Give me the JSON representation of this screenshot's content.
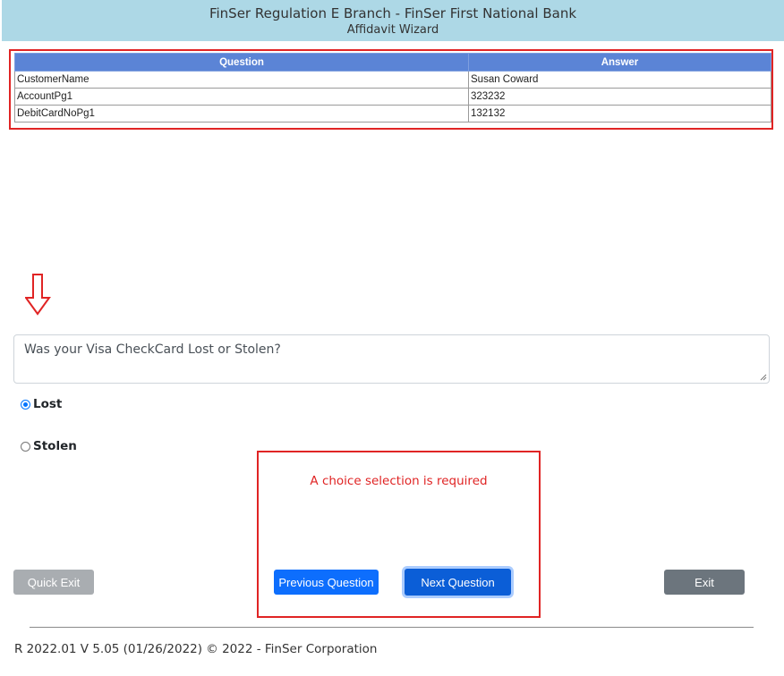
{
  "header": {
    "title": "FinSer Regulation E Branch - FinSer First National Bank",
    "subtitle": "Affidavit Wizard"
  },
  "answers_table": {
    "columns": [
      "Question",
      "Answer"
    ],
    "rows": [
      [
        "CustomerName",
        "Susan Coward"
      ],
      [
        "AccountPg1",
        "323232"
      ],
      [
        "DebitCardNoPg1",
        "132132"
      ]
    ]
  },
  "arrow_icon": "down-arrow-outline-icon",
  "question": {
    "text": "Was your Visa CheckCard Lost or Stolen?"
  },
  "choices": [
    {
      "label": "Lost",
      "selected": true
    },
    {
      "label": "Stolen",
      "selected": false
    }
  ],
  "validation": {
    "message": "A choice selection is required"
  },
  "buttons": {
    "quick_exit": "Quick Exit",
    "previous": "Previous Question",
    "next": "Next Question",
    "exit": "Exit"
  },
  "footer": {
    "text": "R 2022.01 V 5.05 (01/26/2022) © 2022 - FinSer Corporation"
  },
  "colors": {
    "header_bg": "#add8e6",
    "table_header_bg": "#5b84d6",
    "highlight_red": "#e02424",
    "primary_blue": "#0d6efd",
    "secondary_gray": "#6c757d"
  }
}
